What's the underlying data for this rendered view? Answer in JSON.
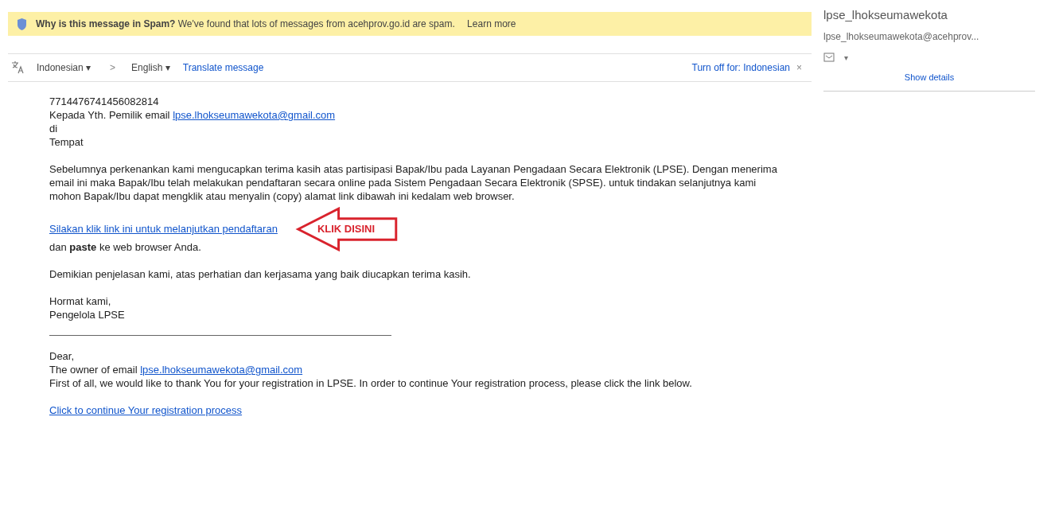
{
  "spam_banner": {
    "title": "Why is this message in Spam?",
    "text": "We've found that lots of messages from acehprov.go.id are spam.",
    "link": "Learn more"
  },
  "translate_bar": {
    "caret": "▾",
    "source": "Indonesian",
    "separator": ">",
    "target": "English",
    "action": "Translate message",
    "turn_off": "Turn off for: Indonesian",
    "close": "×"
  },
  "sender": {
    "name": "lpse_lhokseumawekota",
    "email": "lpse_lhokseumawekota@acehprov...",
    "caret": "▾",
    "details": "Show details"
  },
  "body": {
    "code": "7714476741456082814",
    "greeting_prefix": "Kepada Yth. Pemilik email",
    "greeting_email": "lpse.lhokseumawekota@gmail.com",
    "lines_id": [
      "di",
      "Tempat"
    ],
    "paragraph_id": "Sebelumnya perkenankan kami mengucapkan terima kasih atas partisipasi Bapak/Ibu pada Layanan Pengadaan Secara Elektronik (LPSE). Dengan menerima email ini maka Bapak/Ibu telah melakukan pendaftaran secara online pada Sistem Pengadaan Secara Elektronik (SPSE). untuk tindakan selanjutnya kami mohon Bapak/Ibu dapat mengklik atau menyalin (copy) alamat link dibawah ini kedalam web browser.",
    "link_id": "Silakan klik link ini untuk melanjutkan pendaftaran",
    "arrow_label": "KLIK DISINI",
    "paste_line": "dan **paste** ke web browser Anda.",
    "closing_id": "Demikian penjelasan kami, atas perhatian dan kerjasama yang baik diucapkan terima kasih.",
    "signature": [
      "Hormat kami,",
      "Pengelola LPSE"
    ],
    "dear": "Dear,",
    "owner_prefix": "The owner of email",
    "owner_email": "lpse.lhokseumawekota@gmail.com",
    "paragraph_en": "First of all, we would like to thank You for your registration in LPSE. In order to continue Your registration process, please click the link below.",
    "link_en": "Click to continue Your registration process"
  }
}
